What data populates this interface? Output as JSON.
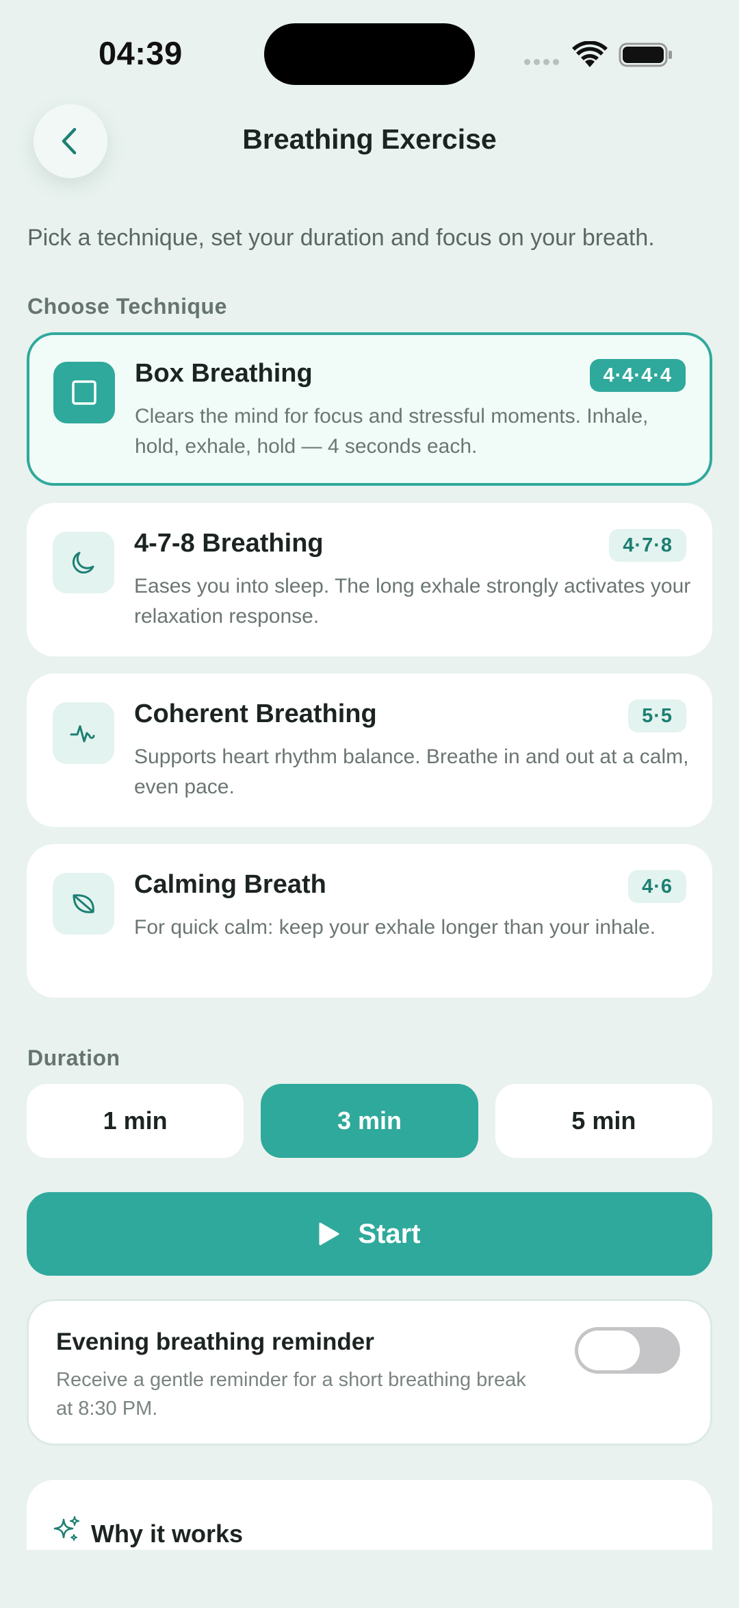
{
  "status_bar": {
    "time": "04:39"
  },
  "header": {
    "title": "Breathing Exercise"
  },
  "intro": "Pick a technique, set your duration and focus on your breath.",
  "technique_section": {
    "label": "Choose Technique",
    "items": [
      {
        "name": "Box Breathing",
        "badge": "4·4·4·4",
        "description": "Clears the mind for focus and stressful moments. Inhale, hold, exhale, hold — 4 seconds each.",
        "icon": "square-icon",
        "selected": true
      },
      {
        "name": "4-7-8 Breathing",
        "badge": "4·7·8",
        "description": "Eases you into sleep. The long exhale strongly activates your relaxation response.",
        "icon": "moon-icon",
        "selected": false
      },
      {
        "name": "Coherent Breathing",
        "badge": "5·5",
        "description": "Supports heart rhythm balance. Breathe in and out at a calm, even pace.",
        "icon": "heartbeat-icon",
        "selected": false
      },
      {
        "name": "Calming Breath",
        "badge": "4·6",
        "description": "For quick calm: keep your exhale longer than your inhale.",
        "icon": "leaf-icon",
        "selected": false
      }
    ]
  },
  "duration": {
    "label": "Duration",
    "options": [
      "1 min",
      "3 min",
      "5 min"
    ],
    "selected": "3 min"
  },
  "start_button": {
    "label": "Start"
  },
  "reminder": {
    "title": "Evening breathing reminder",
    "description": "Receive a gentle reminder for a short breathing break at 8:30 PM.",
    "enabled": false
  },
  "why": {
    "title": "Why it works"
  },
  "colors": {
    "accent": "#2fa99b",
    "background": "#e9f2ef",
    "badge_bg": "#e3f3ef",
    "text": "#1c2421"
  }
}
